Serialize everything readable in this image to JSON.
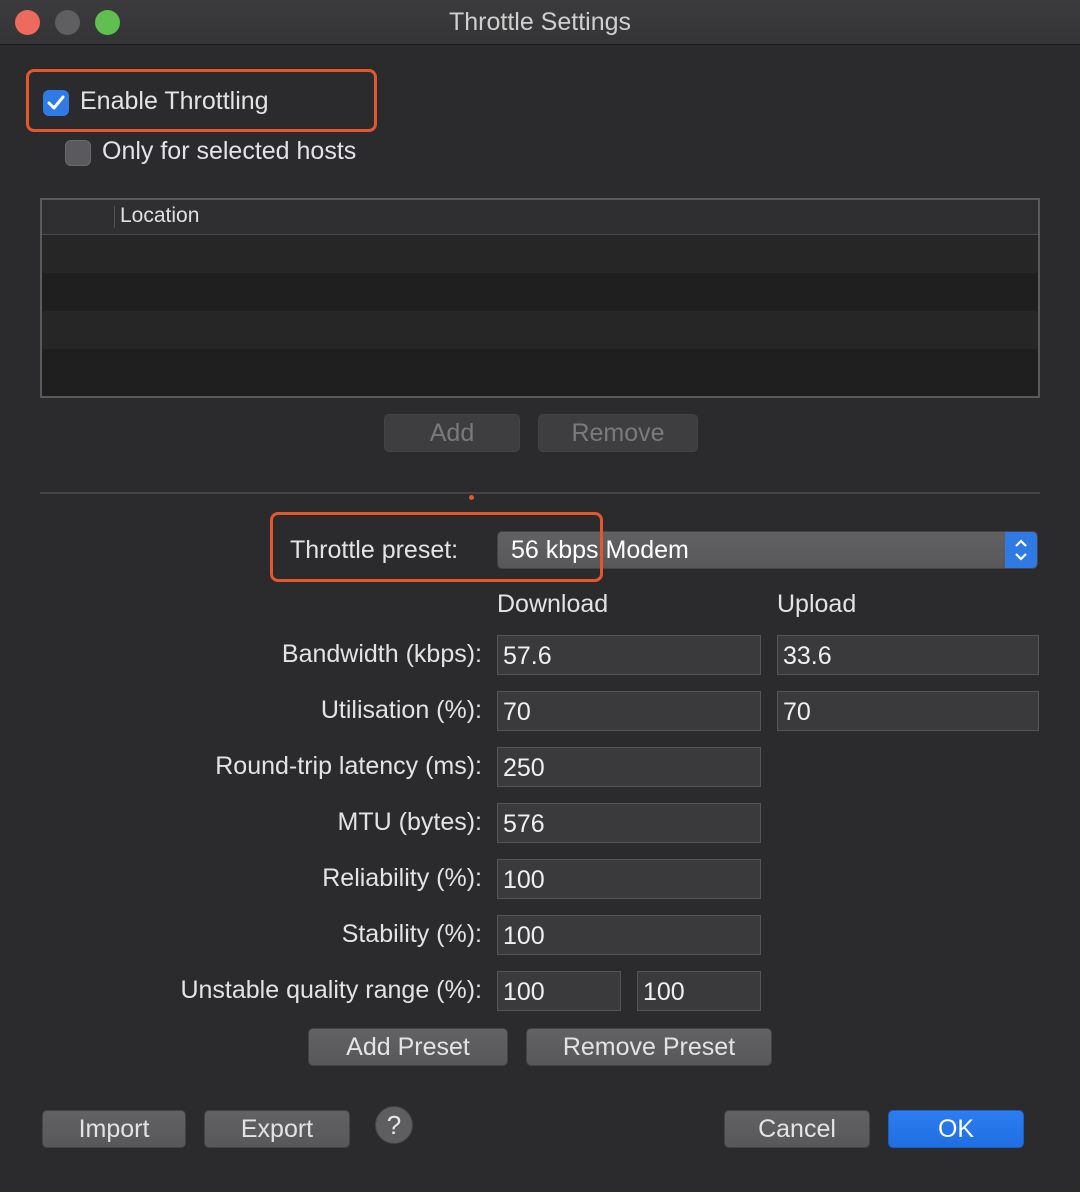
{
  "window": {
    "title": "Throttle Settings"
  },
  "options": {
    "enable_throttling": {
      "label": "Enable Throttling",
      "checked": true
    },
    "only_selected_hosts": {
      "label": "Only for selected hosts",
      "checked": false
    }
  },
  "hosts_table": {
    "columns": [
      "",
      "Location"
    ],
    "rows": []
  },
  "hosts_buttons": {
    "add": "Add",
    "remove": "Remove"
  },
  "preset": {
    "label": "Throttle preset:",
    "value": "56 kbps Modem"
  },
  "columns": {
    "download": "Download",
    "upload": "Upload"
  },
  "fields": {
    "bandwidth": {
      "label": "Bandwidth (kbps):",
      "download": "57.6",
      "upload": "33.6"
    },
    "utilisation": {
      "label": "Utilisation (%):",
      "download": "70",
      "upload": "70"
    },
    "latency": {
      "label": "Round-trip latency (ms):",
      "value": "250"
    },
    "mtu": {
      "label": "MTU (bytes):",
      "value": "576"
    },
    "reliability": {
      "label": "Reliability (%):",
      "value": "100"
    },
    "stability": {
      "label": "Stability (%):",
      "value": "100"
    },
    "unstable_range": {
      "label": "Unstable quality range (%):",
      "min": "100",
      "max": "100"
    }
  },
  "preset_buttons": {
    "add": "Add Preset",
    "remove": "Remove Preset"
  },
  "footer": {
    "import": "Import",
    "export": "Export",
    "help": "?",
    "cancel": "Cancel",
    "ok": "OK"
  },
  "colors": {
    "accent": "#2f7ae5",
    "highlight": "#e4572e",
    "background": "#2b2b2d"
  }
}
